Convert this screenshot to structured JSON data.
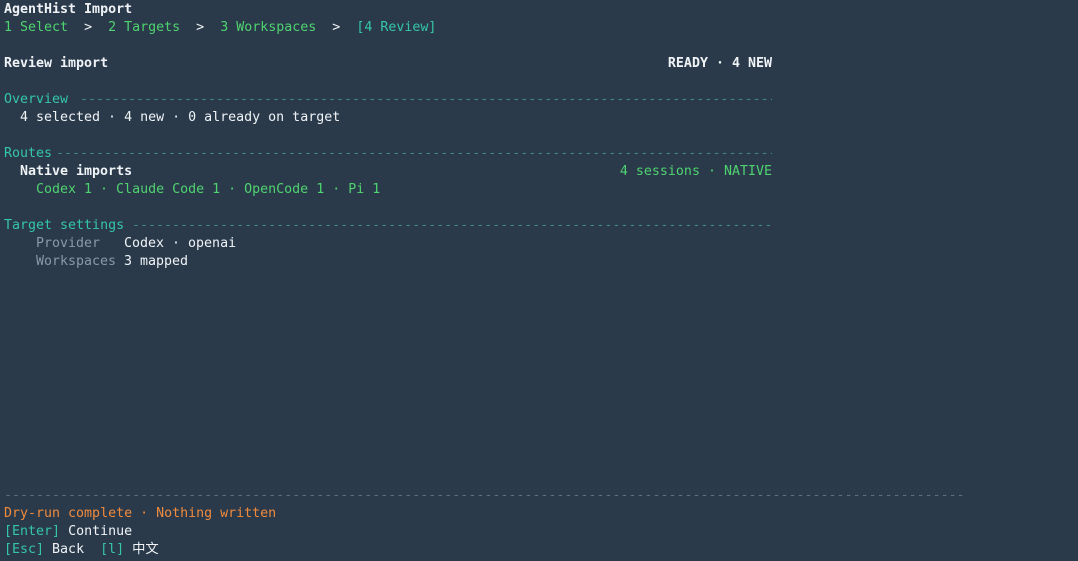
{
  "app": {
    "title": "AgentHist Import"
  },
  "breadcrumb": {
    "steps": [
      {
        "label": "1 Select"
      },
      {
        "label": "2 Targets"
      },
      {
        "label": "3 Workspaces"
      },
      {
        "label": "[4 Review]"
      }
    ],
    "separator": ">"
  },
  "header": {
    "title": "Review import",
    "status": "READY · 4 NEW"
  },
  "overview": {
    "heading": "Overview",
    "summary": "4 selected · 4 new · 0 already on target"
  },
  "routes": {
    "heading": "Routes",
    "native": {
      "label": "Native imports",
      "meta": "4 sessions · NATIVE",
      "breakdown": "Codex 1 · Claude Code 1 · OpenCode 1 · Pi 1"
    }
  },
  "target_settings": {
    "heading": "Target settings",
    "rows": [
      {
        "key": "Provider",
        "value": "Codex · openai"
      },
      {
        "key": "Workspaces",
        "value": "3 mapped"
      }
    ]
  },
  "footer": {
    "status": "Dry-run complete · Nothing written",
    "actions": [
      {
        "key": "[Enter]",
        "label": "Continue"
      },
      {
        "key": "[Esc]",
        "label": "Back"
      },
      {
        "key": "[l]",
        "label": "中文"
      }
    ]
  },
  "colors": {
    "background": "#2a3a4b",
    "accent": "#35c6a6",
    "success": "#4fd36f",
    "warning": "#f08a3c"
  }
}
